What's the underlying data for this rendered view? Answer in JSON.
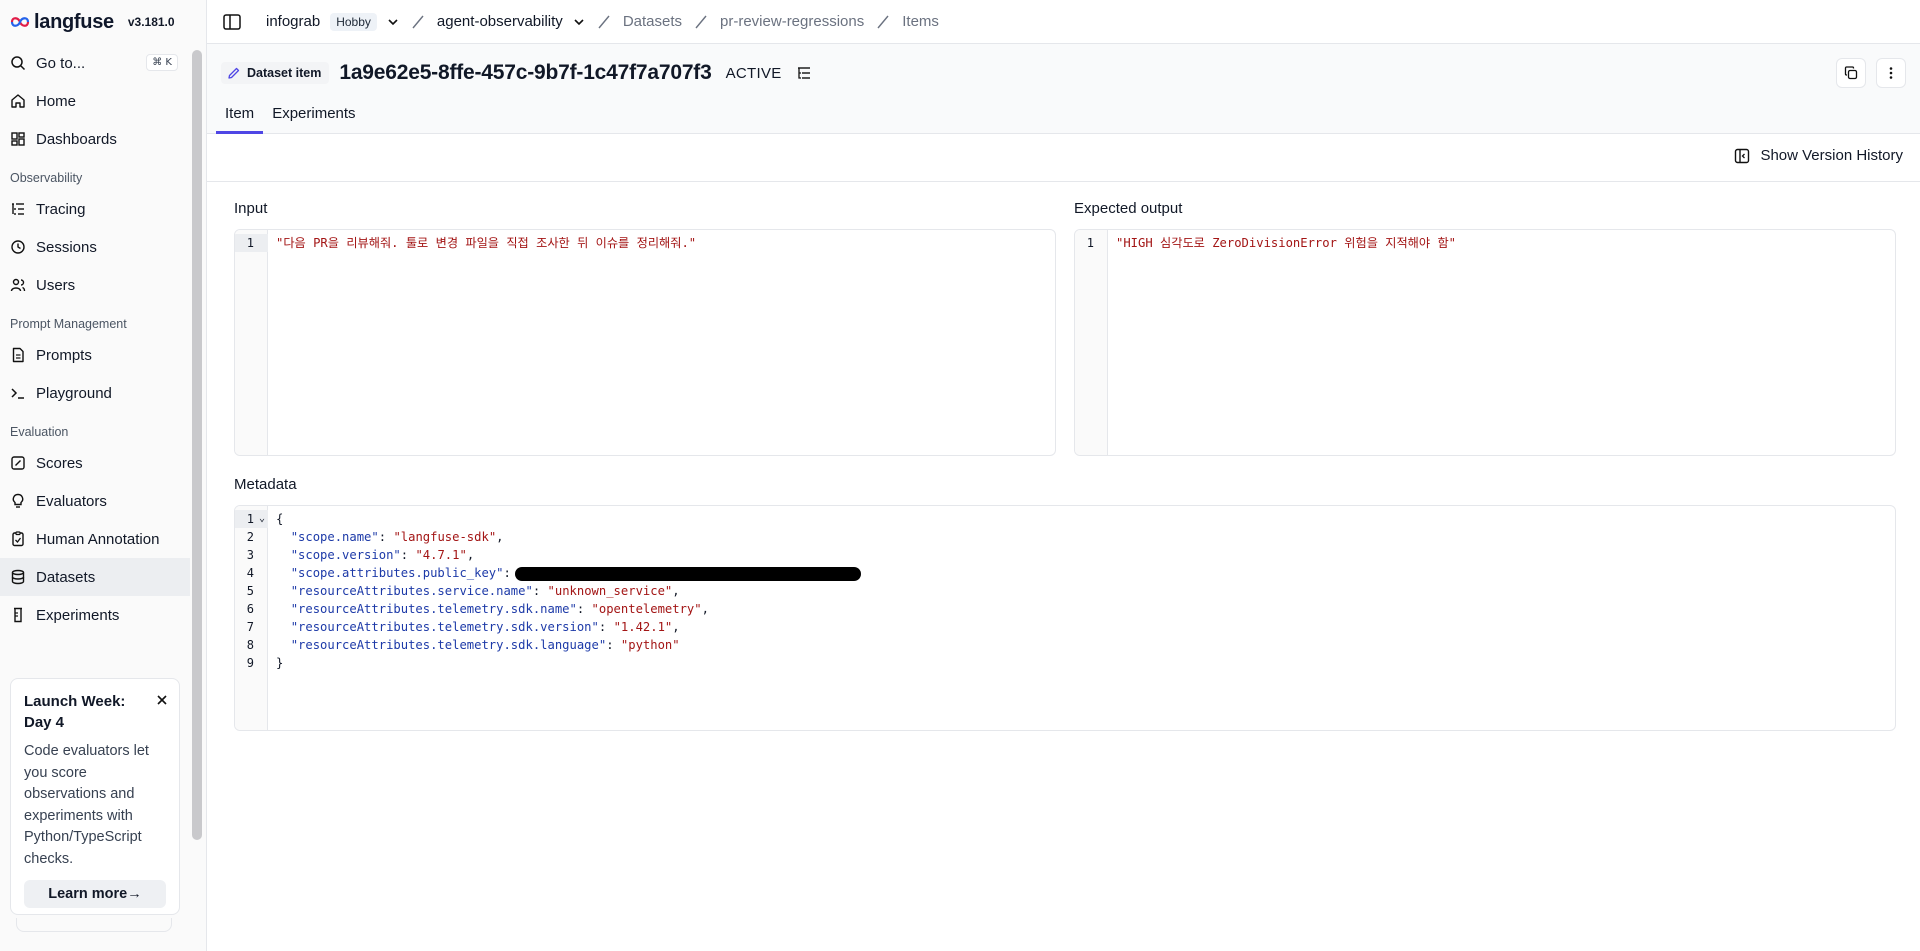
{
  "sidebar": {
    "brand": "langfuse",
    "version": "v3.181.0",
    "goto": {
      "label": "Go to...",
      "shortcut": "⌘ K"
    },
    "top_items": [
      {
        "label": "Home",
        "icon": "home-icon"
      },
      {
        "label": "Dashboards",
        "icon": "dashboard-icon"
      }
    ],
    "sections": [
      {
        "title": "Observability",
        "items": [
          {
            "label": "Tracing",
            "icon": "tracing-icon"
          },
          {
            "label": "Sessions",
            "icon": "clock-icon"
          },
          {
            "label": "Users",
            "icon": "users-icon"
          }
        ]
      },
      {
        "title": "Prompt Management",
        "items": [
          {
            "label": "Prompts",
            "icon": "file-icon"
          },
          {
            "label": "Playground",
            "icon": "terminal-icon"
          }
        ]
      },
      {
        "title": "Evaluation",
        "items": [
          {
            "label": "Scores",
            "icon": "score-icon"
          },
          {
            "label": "Evaluators",
            "icon": "lightbulb-icon"
          },
          {
            "label": "Human Annotation",
            "icon": "annotation-icon"
          },
          {
            "label": "Datasets",
            "icon": "database-icon",
            "active": true
          },
          {
            "label": "Experiments",
            "icon": "flask-icon"
          }
        ]
      }
    ],
    "promo": {
      "title": "Launch Week: Day 4",
      "body": "Code evaluators let you score observations and experiments with Python/TypeScript checks.",
      "cta": "Learn more→"
    }
  },
  "topbar": {
    "org": "infograb",
    "plan": "Hobby",
    "project": "agent-observability",
    "crumbs": [
      "Datasets",
      "pr-review-regressions",
      "Items"
    ]
  },
  "header": {
    "badge": "Dataset item",
    "item_id": "1a9e62e5-8ffe-457c-9b7f-1c47f7a707f3",
    "status": "ACTIVE",
    "tabs": [
      {
        "label": "Item",
        "active": true
      },
      {
        "label": "Experiments",
        "active": false
      }
    ]
  },
  "toolbar": {
    "version_history": "Show Version History"
  },
  "input": {
    "label": "Input",
    "line_no": "1",
    "text": "\"다음 PR을 리뷰해줘. 툴로 변경 파일을 직접 조사한 뒤 이슈를 정리해줘.\""
  },
  "expected_output": {
    "label": "Expected output",
    "line_no": "1",
    "text": "\"HIGH 심각도로 ZeroDivisionError 위험을 지적해야 함\""
  },
  "metadata": {
    "label": "Metadata",
    "lines": [
      {
        "no": "1",
        "key": "",
        "value": "",
        "raw": "{"
      },
      {
        "no": "2",
        "key": "\"scope.name\"",
        "value": "\"langfuse-sdk\""
      },
      {
        "no": "3",
        "key": "\"scope.version\"",
        "value": "\"4.7.1\""
      },
      {
        "no": "4",
        "key": "\"scope.attributes.public_key\"",
        "value": "",
        "redacted": true
      },
      {
        "no": "5",
        "key": "\"resourceAttributes.service.name\"",
        "value": "\"unknown_service\""
      },
      {
        "no": "6",
        "key": "\"resourceAttributes.telemetry.sdk.name\"",
        "value": "\"opentelemetry\""
      },
      {
        "no": "7",
        "key": "\"resourceAttributes.telemetry.sdk.version\"",
        "value": "\"1.42.1\""
      },
      {
        "no": "8",
        "key": "\"resourceAttributes.telemetry.sdk.language\"",
        "value": "\"python\""
      },
      {
        "no": "9",
        "key": "",
        "value": "",
        "raw": "}"
      }
    ]
  },
  "colors": {
    "accent": "#4f46e5",
    "string": "#a31515",
    "key": "#1d3aa8"
  }
}
